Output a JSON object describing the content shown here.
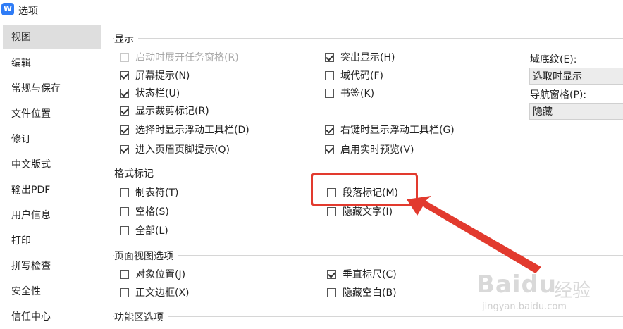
{
  "window": {
    "title": "选项",
    "icon_letter": "W"
  },
  "sidebar": {
    "items": [
      {
        "label": "视图",
        "active": true
      },
      {
        "label": "编辑"
      },
      {
        "label": "常规与保存"
      },
      {
        "label": "文件位置"
      },
      {
        "label": "修订"
      },
      {
        "label": "中文版式"
      },
      {
        "label": "输出PDF"
      },
      {
        "label": "用户信息"
      },
      {
        "label": "打印"
      },
      {
        "label": "拼写检查"
      },
      {
        "label": "安全性"
      },
      {
        "label": "信任中心"
      }
    ]
  },
  "sections": {
    "display": {
      "title": "显示",
      "left": [
        {
          "label": "启动时展开任务窗格(R)",
          "checked": false,
          "disabled": true
        },
        {
          "label": "屏幕提示(N)",
          "checked": true
        },
        {
          "label": "状态栏(U)",
          "checked": true
        },
        {
          "label": "显示裁剪标记(R)",
          "checked": true
        },
        {
          "label": "选择时显示浮动工具栏(D)",
          "checked": true
        },
        {
          "label": "进入页眉页脚提示(Q)",
          "checked": true
        }
      ],
      "right": [
        {
          "label": "突出显示(H)",
          "checked": true
        },
        {
          "label": "域代码(F)",
          "checked": false
        },
        {
          "label": "书签(K)",
          "checked": false
        },
        {
          "label": "右键时显示浮动工具栏(G)",
          "checked": true
        },
        {
          "label": "启用实时预览(V)",
          "checked": true
        }
      ],
      "field_shading_label": "域底纹(E):",
      "field_shading_value": "选取时显示",
      "nav_pane_label": "导航窗格(P):",
      "nav_pane_value": "隐藏"
    },
    "format_marks": {
      "title": "格式标记",
      "left": [
        {
          "label": "制表符(T)",
          "checked": false
        },
        {
          "label": "空格(S)",
          "checked": false
        },
        {
          "label": "全部(L)",
          "checked": false
        }
      ],
      "right": [
        {
          "label": "段落标记(M)",
          "checked": false
        },
        {
          "label": "隐藏文字(I)",
          "checked": false
        }
      ]
    },
    "page_view": {
      "title": "页面视图选项",
      "left": [
        {
          "label": "对象位置(J)",
          "checked": false
        },
        {
          "label": "正文边框(X)",
          "checked": false
        }
      ],
      "right": [
        {
          "label": "垂直标尺(C)",
          "checked": true
        },
        {
          "label": "隐藏空白(B)",
          "checked": false
        }
      ]
    },
    "ribbon": {
      "title": "功能区选项"
    }
  },
  "annotation": {
    "color": "#e23a2e"
  },
  "watermark": {
    "brand": "Baidu",
    "cn": "经验",
    "url": "jingyan.baidu.com"
  }
}
